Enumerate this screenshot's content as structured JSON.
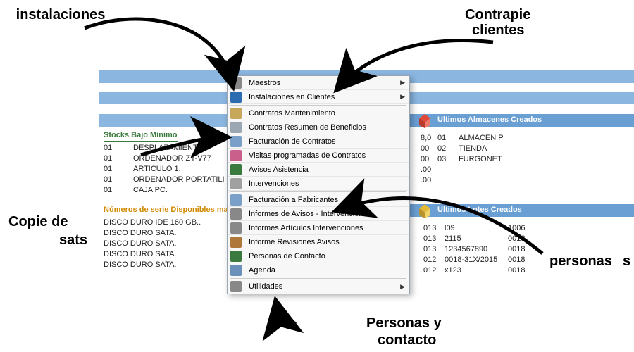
{
  "annotations": {
    "topLeft": "instalaciones",
    "topRight1": "Contrapie",
    "topRight2": "clientes",
    "midLeft1": "Copie de",
    "midLeft2": "sats",
    "midRight1": "personas",
    "midRight2": "s",
    "bottom1": "Personas y",
    "bottom2": "contacto"
  },
  "sections": {
    "stocks_title": "Stocks Bajo Mínimo",
    "series_title": "Números de serie Disponibles mas Antiguo",
    "almacenes_title": "Ultimos Almacenes Creados",
    "lotes_title": "Ultimos Lotes Creados"
  },
  "stocks": [
    {
      "c": "01",
      "n": "DESPLAZAMIENTO."
    },
    {
      "c": "01",
      "n": "ORDENADOR ZY-V77"
    },
    {
      "c": "01",
      "n": "ARTICULO 1."
    },
    {
      "c": "01",
      "n": "ORDENADOR PORTATILI PIV."
    },
    {
      "c": "01",
      "n": "CAJA PC."
    }
  ],
  "series": [
    "DISCO DURO IDE 160 GB..",
    "DISCO DURO SATA.",
    "DISCO DURO SATA.",
    "DISCO DURO SATA.",
    "DISCO DURO SATA."
  ],
  "almacenes": [
    {
      "a": "01",
      "b": "ALMACEN P"
    },
    {
      "a": "02",
      "b": "TIENDA"
    },
    {
      "a": "03",
      "b": "FURGONET"
    }
  ],
  "almacenes_extra": [
    "8,0",
    "00",
    "00",
    ".00",
    ".00"
  ],
  "lotes": [
    {
      "d": "013",
      "l": "l09",
      "x": "1006"
    },
    {
      "d": "013",
      "l": "2115",
      "x": "0018"
    },
    {
      "d": "013",
      "l": "1234567890",
      "x": "0018"
    },
    {
      "d": "012",
      "l": "0018-31X/2015",
      "x": "0018"
    },
    {
      "d": "012",
      "l": "x123",
      "x": "0018"
    }
  ],
  "menu": [
    {
      "label": "Maestros",
      "sub": true,
      "icon": "#888"
    },
    {
      "label": "Instalaciones en Clientes",
      "sub": true,
      "icon": "#2b6cb0"
    },
    {
      "sep": true
    },
    {
      "label": "Contratos Mantenimiento",
      "icon": "#c7a85a"
    },
    {
      "label": "Contratos Resumen de Beneficios",
      "icon": "#9aa6b2"
    },
    {
      "label": "Facturación de Contratos",
      "icon": "#7aa0c9"
    },
    {
      "label": "Visitas programadas de Contratos",
      "icon": "#c95f8a"
    },
    {
      "label": "Avisos Asistencia",
      "icon": "#3a7a3f"
    },
    {
      "label": "Intervenciones",
      "icon": "#a0a0a0"
    },
    {
      "sep": true
    },
    {
      "label": "Facturación a Fabricantes",
      "icon": "#7aa0c9"
    },
    {
      "label": "Informes de Avisos - Intervenciones",
      "icon": "#888"
    },
    {
      "label": "Informes Artículos Intervenciones",
      "icon": "#888"
    },
    {
      "label": "Informe Revisiones Avisos",
      "icon": "#b0773a"
    },
    {
      "label": "Personas de Contacto",
      "icon": "#3a7a3f"
    },
    {
      "label": "Agenda",
      "icon": "#6a8fb8"
    },
    {
      "sep": true
    },
    {
      "label": "Utilidades",
      "sub": true,
      "icon": "#888"
    }
  ]
}
